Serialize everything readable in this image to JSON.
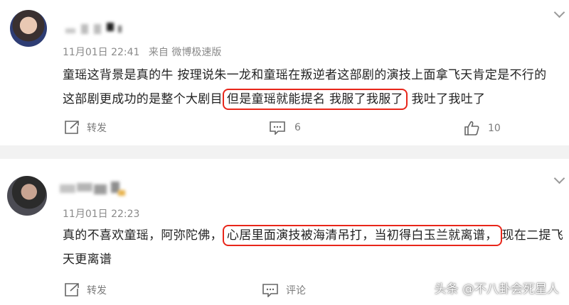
{
  "comments": [
    {
      "username": "▪▪ ▮ ‧",
      "time": "11月01日 22:41",
      "source": "来自 微博极速版",
      "text_pre": "童瑶这背景是真的牛 按理说朱一龙和童瑶在叛逆者这部剧的演技上面拿飞天肯定是不行的 这部剧更成功的是整个大剧目",
      "text_highlight": "但是童瑶就能提名 我服了我服了",
      "text_post": "我吐了我吐了",
      "repost_label": "转发",
      "comment_label": "6",
      "like_count": "10"
    },
    {
      "username": "▪▪▪ ▪",
      "time": "11月01日 22:23",
      "source": "",
      "text_pre": "真的不喜欢童瑶，阿弥陀佛，",
      "text_highlight": "心居里面演技被海清吊打，当初得白玉兰就离谱，",
      "text_post": "现在二提飞天更离谱",
      "repost_label": "转发",
      "comment_label": "评论",
      "like_count": ""
    }
  ],
  "watermark": "头条 @不八卦会死星人",
  "colors": {
    "highlight_border": "#e8261a",
    "separator": "#f2f2f2",
    "meta_text": "#8a8a8a"
  },
  "icons": [
    "repost-icon",
    "comment-icon",
    "like-icon",
    "chevron-down-icon"
  ]
}
